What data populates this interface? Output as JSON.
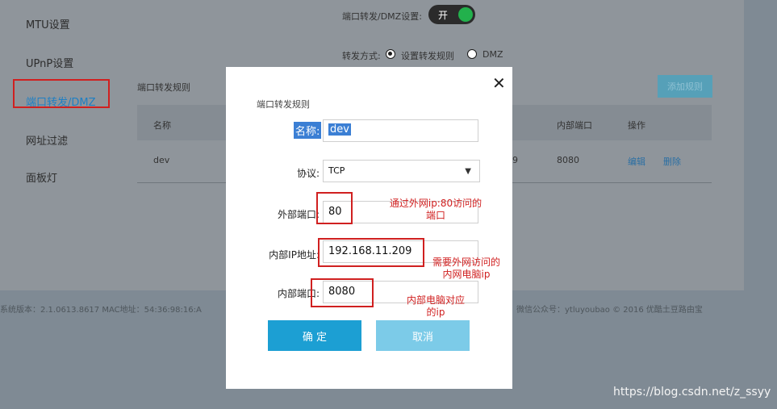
{
  "sidebar": {
    "items": [
      "MTU设置",
      "UPnP设置",
      "端口转发/DMZ",
      "网址过滤",
      "面板灯"
    ]
  },
  "top": {
    "forward_dmz_label": "端口转发/DMZ设置:",
    "toggle_label": "开",
    "mode_label": "转发方式:",
    "mode_option_rule": "设置转发规则",
    "mode_option_dmz": "DMZ"
  },
  "table": {
    "section_title": "端口转发规则",
    "add_button": "添加规则",
    "headers": [
      "名称",
      "内部端口",
      "操作"
    ],
    "row": {
      "name": "dev",
      "partial_ip_tail": "9",
      "internal_port": "8080",
      "edit": "编辑",
      "delete": "删除"
    }
  },
  "footer": {
    "left": "系统版本：2.1.0613.8617   MAC地址：54:36:98:16:A",
    "right": "微信公众号：ytluyoubao  © 2016 优酷土豆路由宝"
  },
  "modal": {
    "title": "端口转发规则",
    "name_label": "名称:",
    "name_value": "dev",
    "protocol_label": "协议:",
    "protocol_value": "TCP",
    "external_port_label": "外部端口:",
    "external_port_value": "80",
    "internal_ip_label": "内部IP地址:",
    "internal_ip_value": "192.168.11.209",
    "internal_port_label": "内部端口:",
    "internal_port_value": "8080",
    "confirm": "确 定",
    "cancel": "取消"
  },
  "annotations": {
    "external_line1": "通过外网ip:80访问的",
    "external_line2": "端口",
    "internal_ip_line1": "需要外网访问的",
    "internal_ip_line2": "内网电脑ip",
    "internal_port_line1": "内部电脑对应",
    "internal_port_line2": "的ip"
  },
  "watermark": "https://blog.csdn.net/z_ssyy",
  "colors": {
    "accent": "#1c9fd3",
    "annotation": "#d02020",
    "toggle_on": "#22b14c"
  }
}
